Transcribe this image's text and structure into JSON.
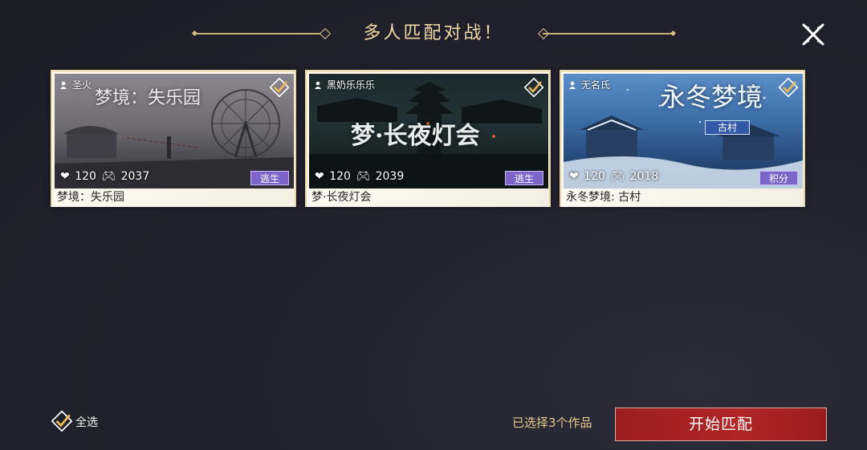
{
  "header": {
    "title": "多人匹配对战！"
  },
  "cards": [
    {
      "author": "圣火",
      "art_title": "梦境：失乐园",
      "likes": "120",
      "plays": "2037",
      "tag": "逃生",
      "caption": "梦境：失乐园"
    },
    {
      "author": "黑奶乐乐乐",
      "art_title": "梦·长夜灯会",
      "likes": "120",
      "plays": "2039",
      "tag": "逃生",
      "caption": "梦·长夜灯会"
    },
    {
      "author": "无名氏",
      "art_title": "永冬梦境",
      "art_subtitle": "古村",
      "likes": "120",
      "plays": "2018",
      "tag": "积分",
      "caption": "永冬梦境: 古村"
    }
  ],
  "footer": {
    "select_all_label": "全选",
    "selected_status": "已选择3个作品",
    "start_button_label": "开始匹配"
  },
  "colors": {
    "accent_gold": "#f1d9a6",
    "tag_purple": "#7d64c8",
    "start_red": "#b12526"
  },
  "icons": [
    "close-icon",
    "person-icon",
    "check-icon",
    "heart-icon",
    "gamepad-icon"
  ]
}
